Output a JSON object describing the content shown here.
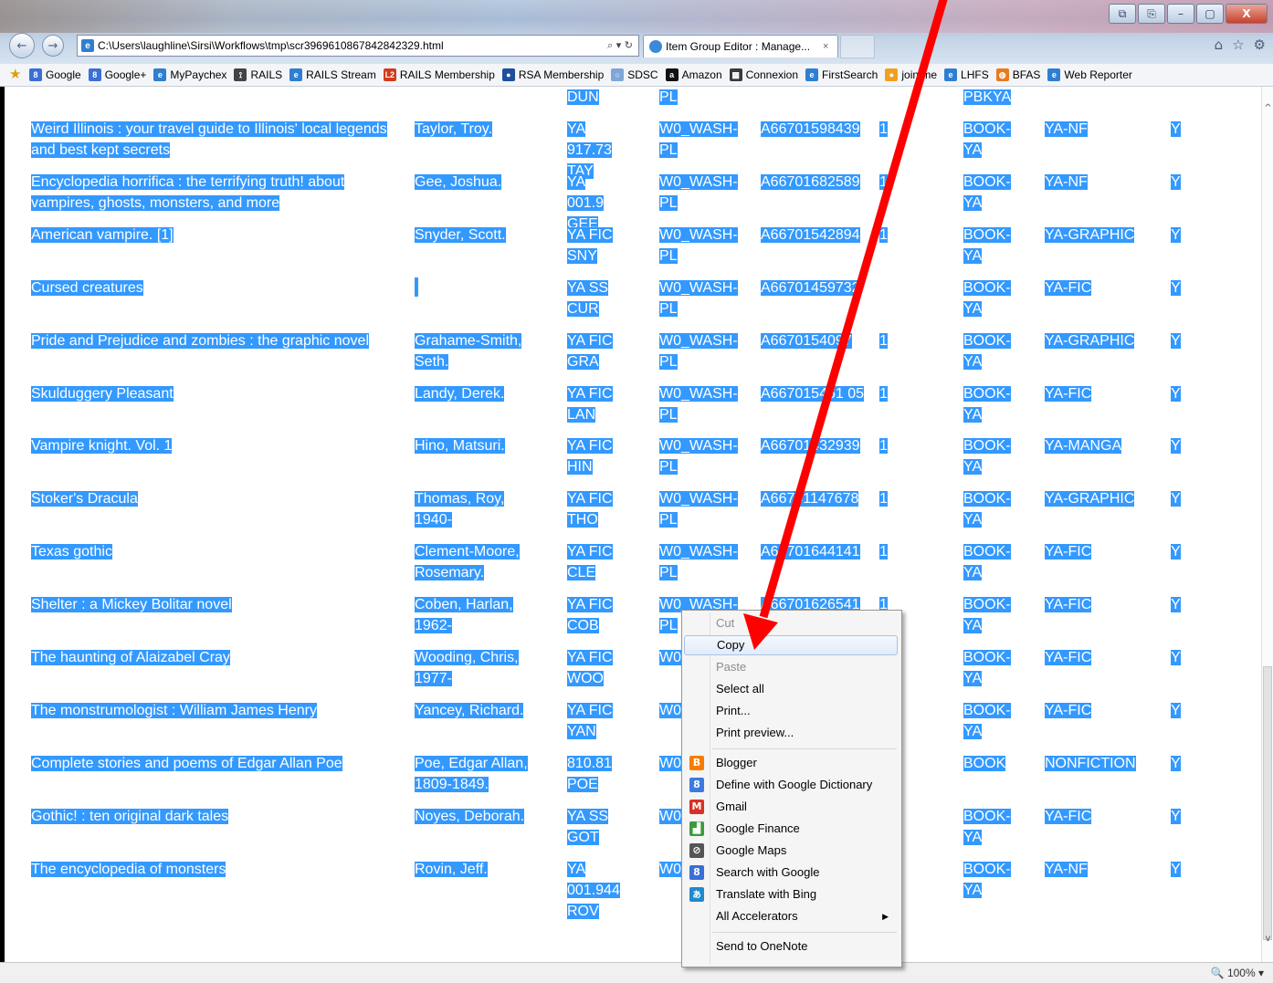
{
  "browser": {
    "address_url": "C:\\Users\\laughline\\Sirsi\\Workflows\\tmp\\scr3969610867842842329.html",
    "address_controls": "⌕ ▾ ↻",
    "tab_title": "Item Group Editor : Manage...",
    "tab_close": "×",
    "window_buttons": [
      "⧉",
      "⎘",
      "–",
      "▢",
      "X"
    ],
    "right_icons": [
      "⌂",
      "☆",
      "⚙"
    ],
    "favorites": [
      {
        "label": "Google",
        "icon": "8",
        "color": "#3a6fd8"
      },
      {
        "label": "Google+",
        "icon": "8",
        "color": "#3a6fd8"
      },
      {
        "label": "MyPaychex",
        "icon": "e",
        "color": "#2f7fd0"
      },
      {
        "label": "RAILS",
        "icon": "⟟",
        "color": "#444444"
      },
      {
        "label": "RAILS Stream",
        "icon": "e",
        "color": "#2f7fd0"
      },
      {
        "label": "RAILS Membership",
        "icon": "L2",
        "color": "#d23b1e"
      },
      {
        "label": "RSA Membership",
        "icon": "●",
        "color": "#1d4f9c"
      },
      {
        "label": "SDSC",
        "icon": "○",
        "color": "#7ea6d8"
      },
      {
        "label": "Amazon",
        "icon": "a",
        "color": "#111111"
      },
      {
        "label": "Connexion",
        "icon": "▩",
        "color": "#3a3a3a"
      },
      {
        "label": "FirstSearch",
        "icon": "e",
        "color": "#2f7fd0"
      },
      {
        "label": "join.me",
        "icon": "●",
        "color": "#f0a020"
      },
      {
        "label": "LHFS",
        "icon": "e",
        "color": "#2f7fd0"
      },
      {
        "label": "BFAS",
        "icon": "◍",
        "color": "#e87a20"
      },
      {
        "label": "Web Reporter",
        "icon": "e",
        "color": "#2f7fd0"
      }
    ],
    "zoom": "100%"
  },
  "top_partial": {
    "call": "DUN",
    "lib": "PL",
    "type": "PBKYA"
  },
  "rows": [
    {
      "title": "Weird Illinois : your travel guide to Illinois' local legends and best kept secrets",
      "author": "Taylor, Troy.",
      "call": "YA 917.73 TAY",
      "lib": "W0_WASH-PL",
      "item": "A66701598439",
      "copy": "1",
      "type": "BOOK-YA",
      "loc": "YA-NF",
      "flag": "Y"
    },
    {
      "title": "Encyclopedia horrifica : the terrifying truth! about vampires, ghosts, monsters, and more",
      "author": "Gee, Joshua.",
      "call": "YA 001.9 GEE",
      "lib": "W0_WASH-PL",
      "item": "A66701682589",
      "copy": "1",
      "type": "BOOK-YA",
      "loc": "YA-NF",
      "flag": "Y"
    },
    {
      "title": "American vampire. [1]",
      "author": "Snyder, Scott.",
      "call": "YA FIC SNY",
      "lib": "W0_WASH-PL",
      "item": "A66701542894",
      "copy": "1",
      "type": "BOOK-YA",
      "loc": "YA-GRAPHIC",
      "flag": "Y"
    },
    {
      "title": "Cursed creatures",
      "author": "",
      "call": "YA SS CUR",
      "lib": "W0_WASH-PL",
      "item": "A66701459732",
      "copy": "",
      "type": "BOOK-YA",
      "loc": "YA-FIC",
      "flag": "Y"
    },
    {
      "title": "Pride and Prejudice and zombies : the graphic novel",
      "author": "Grahame-Smith, Seth.",
      "call": "YA FIC GRA",
      "lib": "W0_WASH-PL",
      "item": "A6670154097",
      "copy": "1",
      "type": "BOOK-YA",
      "loc": "YA-GRAPHIC",
      "flag": "Y"
    },
    {
      "title": "Skulduggery Pleasant",
      "author": "Landy, Derek.",
      "call": "YA FIC LAN",
      "lib": "W0_WASH-PL",
      "item": "A667015461 05",
      "copy": "1",
      "type": "BOOK-YA",
      "loc": "YA-FIC",
      "flag": "Y"
    },
    {
      "title": "Vampire knight. Vol. 1",
      "author": "Hino, Matsuri.",
      "call": "YA FIC HIN",
      "lib": "W0_WASH-PL",
      "item": "A66701432939",
      "copy": "1",
      "type": "BOOK-YA",
      "loc": "YA-MANGA",
      "flag": "Y"
    },
    {
      "title": "Stoker's Dracula",
      "author": "Thomas, Roy, 1940-",
      "call": "YA FIC THO",
      "lib": "W0_WASH-PL",
      "item": "A66701147678",
      "copy": "1",
      "type": "BOOK-YA",
      "loc": "YA-GRAPHIC",
      "flag": "Y"
    },
    {
      "title": "Texas gothic",
      "author": "Clement-Moore, Rosemary.",
      "call": "YA FIC CLE",
      "lib": "W0_WASH-PL",
      "item": "A66701644141",
      "copy": "1",
      "type": "BOOK-YA",
      "loc": "YA-FIC",
      "flag": "Y"
    },
    {
      "title": "Shelter : a Mickey Bolitar novel",
      "author": "Coben, Harlan, 1962-",
      "call": "YA FIC COB",
      "lib": "W0_WASH-PL",
      "item": "A66701626541",
      "copy": "1",
      "type": "BOOK-YA",
      "loc": "YA-FIC",
      "flag": "Y"
    },
    {
      "title": "The haunting of Alaizabel Cray",
      "author": "Wooding, Chris, 1977-",
      "call": "YA FIC WOO",
      "lib": "W0 PL",
      "item": "",
      "copy": "",
      "type": "BOOK-YA",
      "loc": "YA-FIC",
      "flag": "Y"
    },
    {
      "title": "The monstrumologist : William James Henry",
      "author": "Yancey, Richard.",
      "call": "YA FIC YAN",
      "lib": "W0 PL",
      "item": "",
      "copy": "",
      "type": "BOOK-YA",
      "loc": "YA-FIC",
      "flag": "Y"
    },
    {
      "title": "Complete stories and poems of Edgar Allan Poe",
      "author": "Poe, Edgar Allan, 1809-1849.",
      "call": "810.81 POE",
      "lib": "W0 PL",
      "item": "",
      "copy": "",
      "type": "BOOK",
      "loc": "NONFICTION",
      "flag": "Y"
    },
    {
      "title": "Gothic! : ten original dark tales",
      "author": "Noyes, Deborah.",
      "call": "YA SS GOT",
      "lib": "W0 PL",
      "item": "",
      "copy": "",
      "type": "BOOK-YA",
      "loc": "YA-FIC",
      "flag": "Y"
    },
    {
      "title": "The encyclopedia of monsters",
      "author": "Rovin, Jeff.",
      "call": "YA 001.944 ROV",
      "lib": "W0 PL",
      "item": "",
      "copy": "",
      "type": "BOOK-YA",
      "loc": "YA-NF",
      "flag": "Y"
    }
  ],
  "context_menu": {
    "items": [
      {
        "label": "Cut",
        "disabled": true
      },
      {
        "label": "Copy",
        "hover": true
      },
      {
        "label": "Paste",
        "disabled": true
      },
      {
        "label": "Select all"
      },
      {
        "label": "Print..."
      },
      {
        "label": "Print preview..."
      },
      {
        "sep": true
      },
      {
        "label": "Blogger",
        "icon": "B",
        "color": "#f57d00"
      },
      {
        "label": "Define with Google Dictionary",
        "icon": "8",
        "color": "#3b7be0"
      },
      {
        "label": "Gmail",
        "icon": "M",
        "color": "#d93025"
      },
      {
        "label": "Google Finance",
        "icon": "▟",
        "color": "#3b9b3b"
      },
      {
        "label": "Google Maps",
        "icon": "⊘",
        "color": "#555555"
      },
      {
        "label": "Search with Google",
        "icon": "8",
        "color": "#3a6fd8"
      },
      {
        "label": "Translate with Bing",
        "icon": "ぁ",
        "color": "#1e8ad0"
      },
      {
        "label": "All Accelerators",
        "submenu": true
      },
      {
        "sep": true
      },
      {
        "label": "Send to OneNote"
      }
    ]
  },
  "colors": {
    "selection": "#3399ff",
    "annotation_arrow": "#ff0000"
  }
}
